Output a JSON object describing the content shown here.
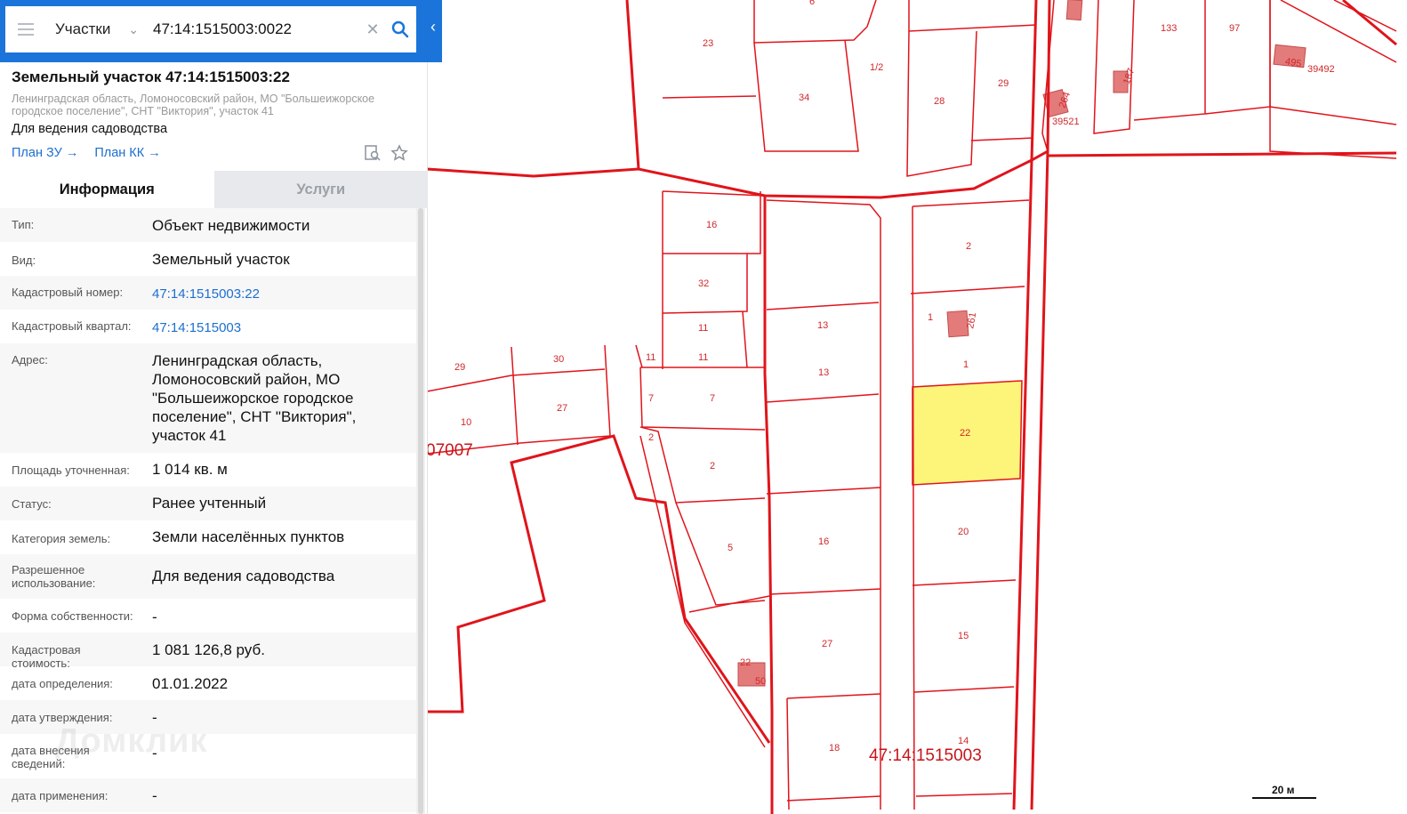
{
  "search": {
    "category": "Участки",
    "query": "47:14:1515003:0022"
  },
  "header": {
    "title": "Земельный участок 47:14:1515003:22",
    "address": "Ленинградская область, Ломоносовский район, МО \"Большеижорское городское поселение\", СНТ \"Виктория\", участок 41",
    "use": "Для ведения садоводства",
    "link_plan_zu": "План ЗУ",
    "link_plan_kk": "План КК"
  },
  "tabs": [
    "Информация",
    "Услуги"
  ],
  "rows": [
    {
      "label": "Тип:",
      "value": "Объект недвижимости"
    },
    {
      "label": "Вид:",
      "value": "Земельный участок"
    },
    {
      "label": "Кадастровый номер:",
      "value": "47:14:1515003:22"
    },
    {
      "label": "Кадастровый квартал:",
      "value": "47:14:1515003"
    },
    {
      "label": "Адрес:",
      "value": "Ленинградская область, Ломоносовский район, МО \"Большеижорское городское поселение\", СНТ \"Виктория\", участок 41"
    },
    {
      "label": "Площадь уточненная:",
      "value": "1 014 кв. м"
    },
    {
      "label": "Статус:",
      "value": "Ранее учтенный"
    },
    {
      "label": "Категория земель:",
      "value": "Земли населённых пунктов"
    },
    {
      "label": "Разрешенное использование:",
      "value": "Для ведения садоводства"
    },
    {
      "label": "Форма собственности:",
      "value": "-"
    },
    {
      "label": "Кадастровая стоимость:",
      "value": "1 081 126,8 руб."
    },
    {
      "label": "дата определения:",
      "value": "01.01.2022"
    },
    {
      "label": "дата утверждения:",
      "value": "-"
    },
    {
      "label": "дата внесения сведений:",
      "value": "-"
    },
    {
      "label": "дата применения:",
      "value": "-"
    }
  ],
  "watermark": "Домклик",
  "map": {
    "quarter_label": "47:14:1515003",
    "quarter_label_left": "07007",
    "selected_plot": "22",
    "scale": "20 м",
    "plot_numbers": [
      "6",
      "23",
      "1/2",
      "28",
      "29",
      "34",
      "264",
      "39521",
      "187",
      "133",
      "97",
      "495",
      "39492",
      "16",
      "32",
      "2",
      "11",
      "13",
      "261",
      "1",
      "29",
      "30",
      "11",
      "27",
      "10",
      "7",
      "22",
      "2",
      "20",
      "5",
      "16",
      "15",
      "27",
      "22",
      "50",
      "18",
      "14"
    ],
    "colors": {
      "boundary": "#e0141b",
      "selected_fill": "#fdf57a",
      "panel_header": "#1b74d9"
    }
  }
}
